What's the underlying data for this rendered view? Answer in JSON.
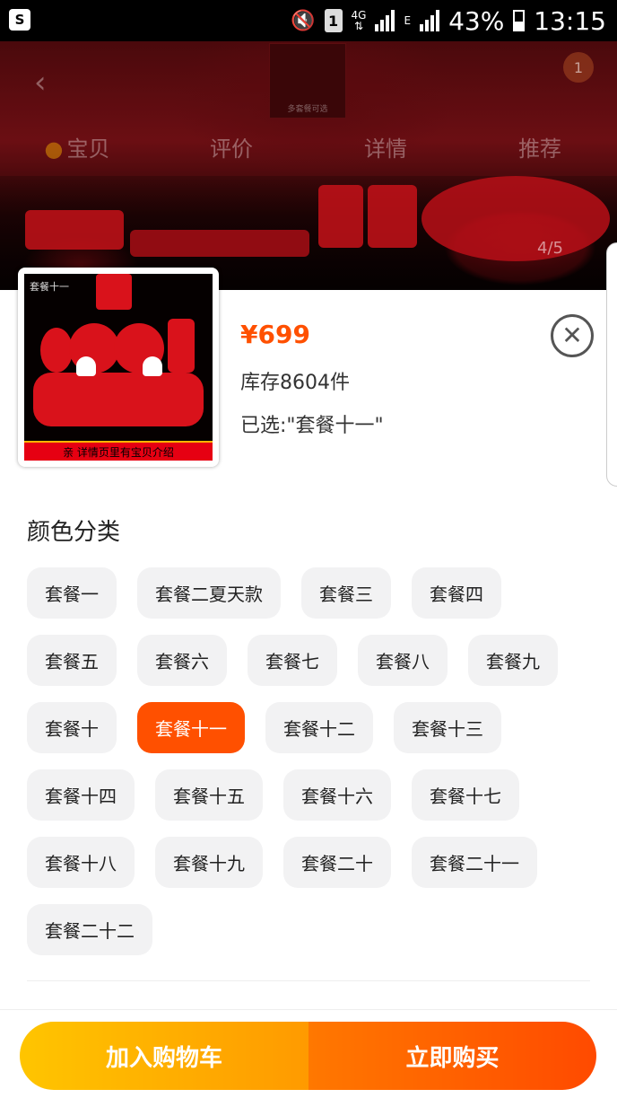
{
  "status_bar": {
    "battery": "43%",
    "time": "13:15",
    "sim": "1",
    "network": "4G",
    "network_edge": "E"
  },
  "hero": {
    "tabs": [
      "宝贝",
      "评价",
      "详情",
      "推荐"
    ],
    "cart_badge": "1",
    "page_indicator": "4/5",
    "thumb_caption": "多套餐可选"
  },
  "product": {
    "image_label": "套餐十一",
    "image_banner": "亲 详情页里有宝贝介绍",
    "price": "¥699",
    "stock": "库存8604件",
    "selected": "已选:\"套餐十一\""
  },
  "section": {
    "title": "颜色分类"
  },
  "options": [
    {
      "label": "套餐一",
      "active": false
    },
    {
      "label": "套餐二夏天款",
      "active": false
    },
    {
      "label": "套餐三",
      "active": false
    },
    {
      "label": "套餐四",
      "active": false
    },
    {
      "label": "套餐五",
      "active": false
    },
    {
      "label": "套餐六",
      "active": false
    },
    {
      "label": "套餐七",
      "active": false
    },
    {
      "label": "套餐八",
      "active": false
    },
    {
      "label": "套餐九",
      "active": false
    },
    {
      "label": "套餐十",
      "active": false
    },
    {
      "label": "套餐十一",
      "active": true
    },
    {
      "label": "套餐十二",
      "active": false
    },
    {
      "label": "套餐十三",
      "active": false
    },
    {
      "label": "套餐十四",
      "active": false
    },
    {
      "label": "套餐十五",
      "active": false
    },
    {
      "label": "套餐十六",
      "active": false
    },
    {
      "label": "套餐十七",
      "active": false
    },
    {
      "label": "套餐十八",
      "active": false
    },
    {
      "label": "套餐十九",
      "active": false
    },
    {
      "label": "套餐二十",
      "active": false
    },
    {
      "label": "套餐二十一",
      "active": false
    },
    {
      "label": "套餐二十二",
      "active": false
    }
  ],
  "actions": {
    "add_to_cart": "加入购物车",
    "buy_now": "立即购买"
  },
  "colors": {
    "accent": "#ff5000",
    "cart_gradient_start": "#ffc500",
    "buy_gradient_end": "#ff4a00"
  }
}
